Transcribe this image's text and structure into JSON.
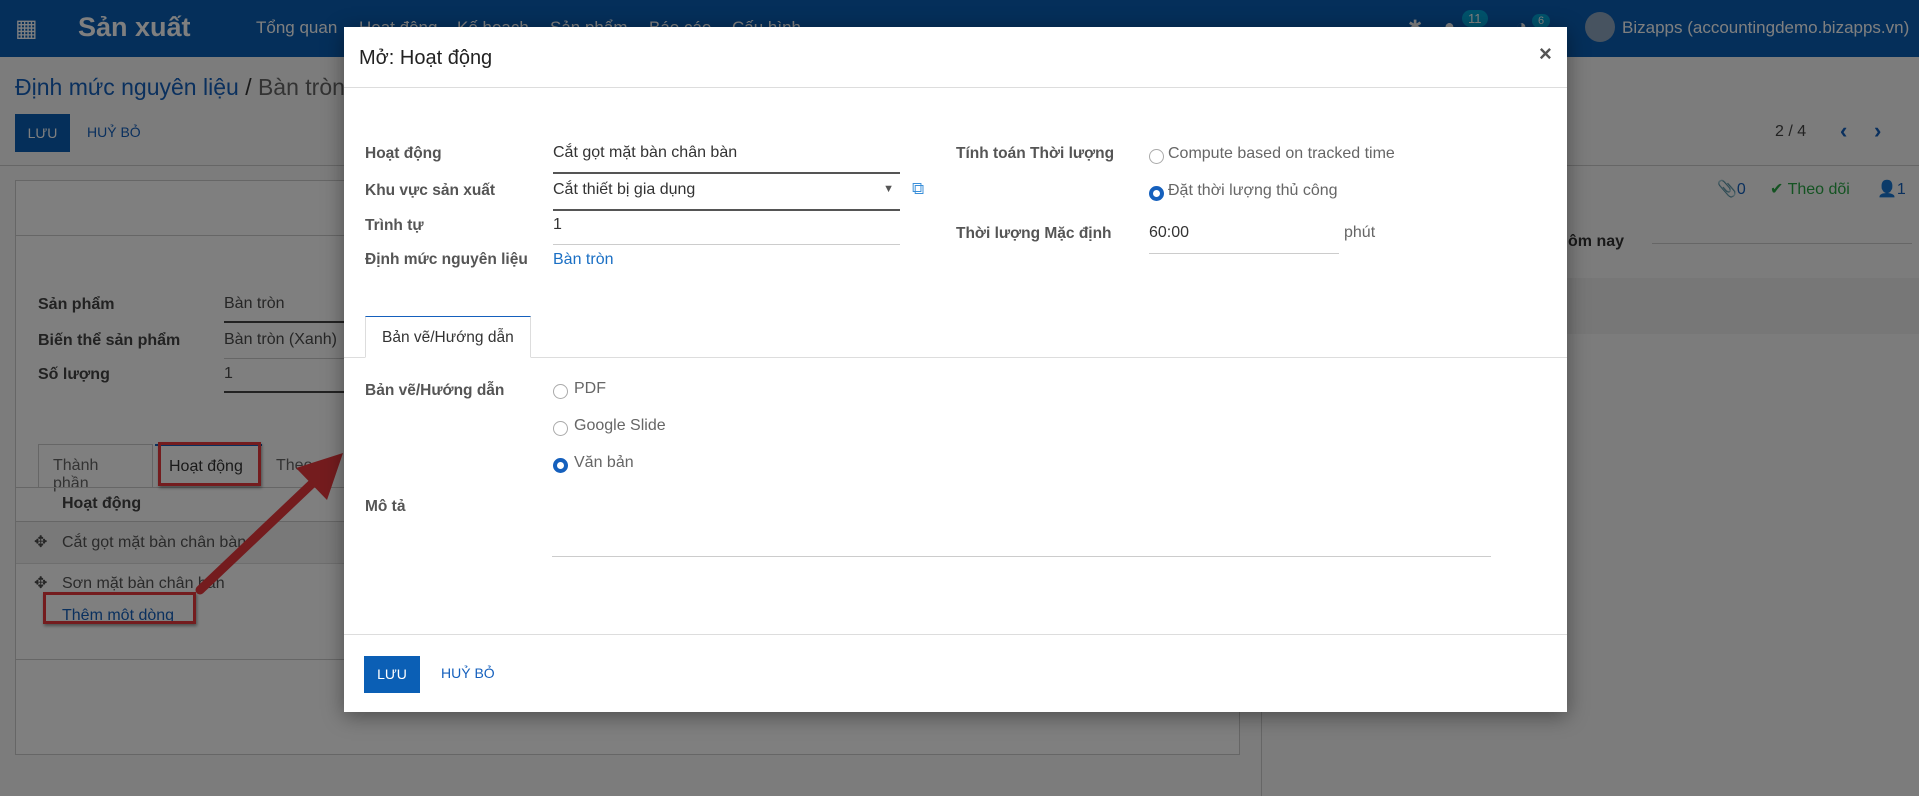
{
  "navbar": {
    "app_title": "Sản xuất",
    "menu": [
      "Tổng quan",
      "Hoạt động",
      "Kế hoạch",
      "Sản phẩm",
      "Báo cáo",
      "Cấu hình"
    ],
    "chat_count": "11",
    "activity_count": "6",
    "user": "Bizapps (accountingdemo.bizapps.vn)"
  },
  "page": {
    "breadcrumb_parent": "Định mức nguyên liệu",
    "breadcrumb_sep": "/",
    "breadcrumb_current": "Bàn tròn",
    "save": "LƯU",
    "discard": "HUỶ BỎ",
    "pager": "2 / 4",
    "fields": [
      {
        "label": "Sản phẩm",
        "value": "Bàn tròn"
      },
      {
        "label": "Biến thể sản phẩm",
        "value": "Bàn tròn (Xanh)"
      },
      {
        "label": "Số lượng",
        "value": "1"
      }
    ],
    "tabs": [
      "Thành phần",
      "Hoạt động",
      "Theo"
    ],
    "table_header": "Hoạt động",
    "rows": [
      "Cắt gọt mặt bàn chân bàn",
      "Sơn mặt bàn chân bàn"
    ],
    "add_line": "Thêm một dòng"
  },
  "chatter": {
    "attachments": "0",
    "follow": "Theo dõi",
    "followers": "1",
    "today": "ôm nay"
  },
  "modal": {
    "title": "Mở: Hoạt động",
    "close": "×",
    "left_fields": [
      {
        "label": "Hoạt động",
        "value": "Cắt gọt mặt bàn chân bàn"
      },
      {
        "label": "Khu vực sản xuất",
        "value": "Cắt thiết bị gia dụng"
      },
      {
        "label": "Trình tự",
        "value": "1"
      },
      {
        "label": "Định mức nguyên liệu",
        "value": "Bàn tròn"
      }
    ],
    "duration_label": "Tính toán Thời lượng",
    "duration_options": [
      "Compute based on tracked time",
      "Đặt thời lượng thủ công"
    ],
    "duration_selected": 1,
    "default_duration_label": "Thời lượng Mặc định",
    "default_duration": "60:00",
    "unit": "phút",
    "tab": "Bản vẽ/Hướng dẫn",
    "worksheet_label": "Bản vẽ/Hướng dẫn",
    "worksheet_options": [
      "PDF",
      "Google Slide",
      "Văn bản"
    ],
    "worksheet_selected": 2,
    "description_label": "Mô tả",
    "save": "LƯU",
    "cancel": "HUỶ BỎ"
  }
}
